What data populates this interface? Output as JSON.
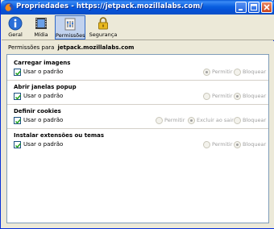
{
  "window": {
    "title": "Propriedades - https://jetpack.mozillalabs.com/"
  },
  "toolbar": {
    "items": [
      {
        "label": "Geral",
        "icon": "info-icon"
      },
      {
        "label": "Mídia",
        "icon": "media-film-icon"
      },
      {
        "label": "Permissões",
        "icon": "permissions-icon",
        "selected": true
      },
      {
        "label": "Segurança",
        "icon": "padlock-icon"
      }
    ]
  },
  "pane": {
    "permissions_for_label": "Permissões para",
    "site": "jetpack.mozillalabs.com"
  },
  "groups": [
    {
      "title": "Carregar imagens",
      "use_default": "Usar o padrão",
      "use_default_checked": true,
      "options": [
        {
          "label": "Permitir",
          "selected": true
        },
        {
          "label": "Bloquear",
          "selected": false
        }
      ]
    },
    {
      "title": "Abrir janelas popup",
      "use_default": "Usar o padrão",
      "use_default_checked": true,
      "options": [
        {
          "label": "Permitir",
          "selected": false
        },
        {
          "label": "Bloquear",
          "selected": true
        }
      ]
    },
    {
      "title": "Definir cookies",
      "use_default": "Usar o padrão",
      "use_default_checked": true,
      "options": [
        {
          "label": "Permitir",
          "selected": false
        },
        {
          "label": "Excluir ao sair",
          "selected": true
        },
        {
          "label": "Bloquear",
          "selected": false
        }
      ]
    },
    {
      "title": "Instalar extensões ou temas",
      "use_default": "Usar o padrão",
      "use_default_checked": true,
      "options": [
        {
          "label": "Permitir",
          "selected": false
        },
        {
          "label": "Bloquear",
          "selected": true
        }
      ]
    }
  ],
  "colors": {
    "titlebar": "#0a5fe0",
    "selected_tab": "#c1d2ee",
    "list_border": "#7f9db9"
  }
}
